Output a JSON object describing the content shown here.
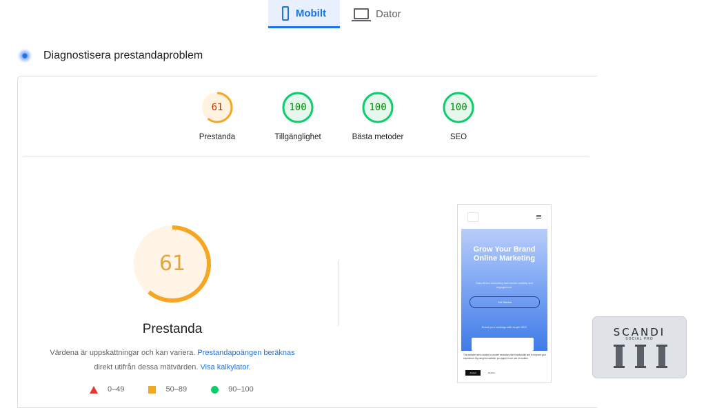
{
  "tabs": [
    {
      "label": "Mobilt",
      "active": true,
      "icon": "smartphone-icon"
    },
    {
      "label": "Dator",
      "active": false,
      "icon": "laptop-icon"
    }
  ],
  "diagnose": {
    "title": "Diagnostisera prestandaproblem",
    "icon": "diagnostics-icon"
  },
  "scores": [
    {
      "value": "61",
      "label": "Prestanda",
      "fraction": 0.61,
      "color": "#f5a623",
      "bg": "#fff3e0",
      "text_color": "#c33300"
    },
    {
      "value": "100",
      "label": "Tillgänglighet",
      "fraction": 1.0,
      "color": "#0cce6b",
      "bg": "#e6f7ee",
      "text_color": "#008800"
    },
    {
      "value": "100",
      "label": "Bästa metoder",
      "fraction": 1.0,
      "color": "#0cce6b",
      "bg": "#e6f7ee",
      "text_color": "#008800"
    },
    {
      "value": "100",
      "label": "SEO",
      "fraction": 1.0,
      "color": "#0cce6b",
      "bg": "#e6f7ee",
      "text_color": "#008800"
    }
  ],
  "performance": {
    "value": "61",
    "fraction": 0.61,
    "label": "Prestanda",
    "desc_text": "Värdena är uppskattningar och kan variera.",
    "desc_link1": "Prestandapoängen beräknas",
    "desc_text2": "direkt utifrån dessa mätvärden.",
    "desc_link2": "Visa kalkylator."
  },
  "legend": [
    {
      "range": "0–49",
      "icon": "triangle-icon",
      "color": "#e53935"
    },
    {
      "range": "50–89",
      "icon": "square-icon",
      "color": "#f5a623"
    },
    {
      "range": "90–100",
      "icon": "circle-icon",
      "color": "#0cce6b"
    }
  ],
  "screenshot": {
    "headline": "Grow Your Brand Online Marketing",
    "subtext": "Data-driven marketing that boosts visibility and engagement.",
    "cta": "Get Started",
    "boost": "Boost your rankings with expert SEO",
    "cookie_text": "This website uses cookies to provide necessary site functionality and to improve your experience. By using this website, you agree to our use of cookies.",
    "accept": "Accept",
    "decline": "Decline"
  },
  "watermark": {
    "brand": "SCANDI",
    "tagline": "SOCIAL PRO"
  },
  "colors": {
    "accent": "#1a73e8",
    "average": "#f5a623",
    "pass": "#0cce6b",
    "fail": "#e53935"
  }
}
